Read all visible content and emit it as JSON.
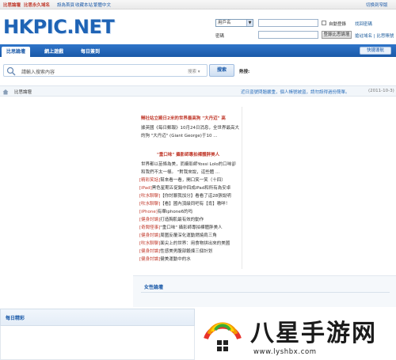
{
  "topbar": {
    "links": [
      "比思論壇",
      "比思永久域名",
      "設為首頁",
      "收藏本站",
      "繁體中文"
    ],
    "right_link": "切换到窄版"
  },
  "header": {
    "logo": "HKPIC.NET"
  },
  "login": {
    "username_select": "用戶名",
    "auto_login": "自動登錄",
    "forgot_password": "找回密碼",
    "password_label": "密碼",
    "login_button": "登錄比思論壇",
    "register_link": "搶註域名 | 比思賬號"
  },
  "nav": {
    "tabs": [
      "比思論壇",
      "網上遊戲",
      "每日簽到"
    ],
    "quick": "快捷導航"
  },
  "search": {
    "placeholder": "請輸入搜索內容",
    "scope": "搜索",
    "button": "搜索",
    "hot_label": "熱搜:"
  },
  "breadcrumb": {
    "crumb": "比思論壇",
    "notice": "近日盜號問題嚴重，個人帳號被盜，請勿設得過份簡單。",
    "date": "(2011-10-3)"
  },
  "article": {
    "headline": "辯社站立殿日2米的世界最高狗 \"大丹迈\" 高",
    "para1": "據英國《每日郵報》10月24日消息，全世界最高大的狗 \"大丹迈\" (Giant George)于10 ...",
    "subhead": "\"重口味\" 攝影師專拍裸體胖美人",
    "para2": "世界都以苗條為美，而攝影師Yossi Lolo的口味卻和我們不太一樣。 \"對我來說，這些體 ..."
  },
  "news": [
    {
      "tag": "[精彩笑話]",
      "text": "幫來看一看，開口笑一笑（十四）"
    },
    {
      "tag": "[iPad]",
      "text": "黑色星期五促銷中四成iPad和所有為安卓"
    },
    {
      "tag": "[吹水聊聊]",
      "text": "【你討厭我加分】看看了這28張說明"
    },
    {
      "tag": "[吹水聊聊]",
      "text": "【看】國內頂級同吧有【肯】嗷咩！"
    },
    {
      "tag": "[iPhone]",
      "text": "有華iphone6的吗"
    },
    {
      "tag": "[健身討論]",
      "text": "打造胸肌最有效的動作"
    },
    {
      "tag": "[奇聞怪事]",
      "text": "\"重口味\" 攝影師專拍裸體胖美人"
    },
    {
      "tag": "[健身討論]",
      "text": "周圍反覆深化運動燃燒肩三角"
    },
    {
      "tag": "[吹水聊聊]",
      "text": "面尖上的世界：用食物拼出來的美國"
    },
    {
      "tag": "[健身討論]",
      "text": "性感美男腹部鍛煉三個計划"
    },
    {
      "tag": "[健身討論]",
      "text": "健美運動中的水"
    }
  ],
  "attachments": {
    "label": "女性論壇"
  },
  "daily": {
    "label": "每日精彩"
  },
  "watermark": {
    "name": "八星手游网",
    "url": "www.lyshbx.com"
  },
  "colors": {
    "nav_blue": "#1a59a8",
    "link_red": "#c0392b",
    "logo_blue": "#1e63b5"
  }
}
